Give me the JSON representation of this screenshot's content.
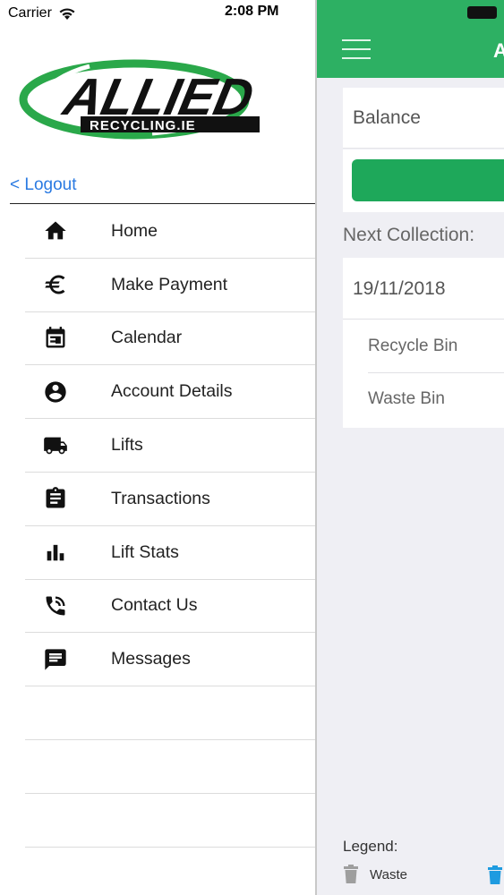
{
  "status_bar": {
    "carrier": "Carrier",
    "time": "2:08 PM"
  },
  "logo": {
    "text": "ALLIED",
    "subtext": "RECYCLING.IE",
    "brand_color": "#2aa84a"
  },
  "drawer": {
    "logout_label": "< Logout",
    "items": [
      {
        "label": "Home",
        "icon": "home-icon"
      },
      {
        "label": "Make Payment",
        "icon": "euro-icon"
      },
      {
        "label": "Calendar",
        "icon": "calendar-icon"
      },
      {
        "label": "Account Details",
        "icon": "account-icon"
      },
      {
        "label": "Lifts",
        "icon": "truck-icon"
      },
      {
        "label": "Transactions",
        "icon": "clipboard-icon"
      },
      {
        "label": "Lift Stats",
        "icon": "bar-chart-icon"
      },
      {
        "label": "Contact Us",
        "icon": "phone-icon"
      },
      {
        "label": "Messages",
        "icon": "message-icon"
      }
    ]
  },
  "main": {
    "header_title_partial": "A",
    "header_color": "#2db063",
    "balance_label": "Balance",
    "next_collection_label": "Next Collection:",
    "collection_date": "19/11/2018",
    "bins": [
      "Recycle Bin",
      "Waste Bin"
    ],
    "legend_label": "Legend:",
    "legend_waste": "Waste",
    "waste_color": "#9e9e9e",
    "recycle_color": "#1e9be0"
  }
}
